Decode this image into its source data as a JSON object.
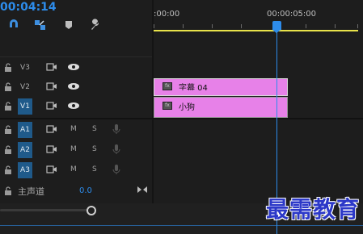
{
  "timecode": "00:04:14",
  "ruler": {
    "labels": [
      ":00:00",
      "00:00:05:00"
    ]
  },
  "video_tracks": [
    {
      "name": "V3",
      "selected": false
    },
    {
      "name": "V2",
      "selected": false
    },
    {
      "name": "V1",
      "selected": true
    }
  ],
  "audio_tracks": [
    {
      "name": "A1",
      "mute": "M",
      "solo": "S"
    },
    {
      "name": "A2",
      "mute": "M",
      "solo": "S"
    },
    {
      "name": "A3",
      "mute": "M",
      "solo": "S"
    }
  ],
  "master": {
    "label": "主声道",
    "value": "0.0"
  },
  "clips": [
    {
      "label": "字幕 04",
      "fx": "fx"
    },
    {
      "label": "小狗",
      "fx": "fx"
    }
  ],
  "watermark": "最需教育",
  "colors": {
    "accent": "#2d8ceb",
    "clip": "#e781e8",
    "yellow": "#e8e24a"
  },
  "icons": [
    "magnet-icon",
    "linked-selection-icon",
    "marker-icon",
    "wrench-icon",
    "lock-icon",
    "camera-icon",
    "eye-icon",
    "microphone-icon",
    "audio-meter-icon"
  ]
}
